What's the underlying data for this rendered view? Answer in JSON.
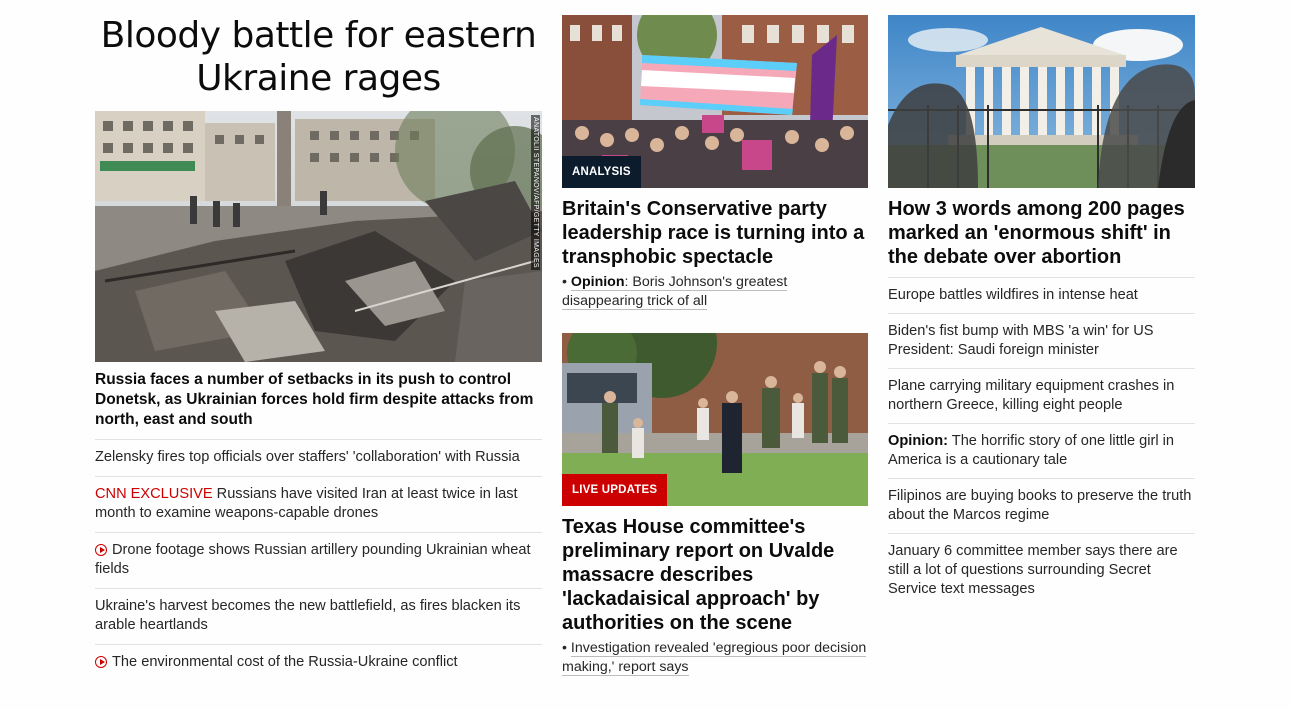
{
  "col1": {
    "headline": "Bloody battle for eastern Ukraine rages",
    "image_credit": "ANATOLII STEPANOV/AFP/GETTY IMAGES",
    "lead": "Russia faces a number of setbacks in its push to control Donetsk, as Ukrainian forces hold firm despite attacks from north, east and south",
    "items": [
      {
        "text": "Zelensky fires top officials over staffers' 'collaboration' with Russia"
      },
      {
        "prefix": "CNN EXCLUSIVE",
        "text": " Russians have visited Iran at least twice in last month to examine weapons-capable drones"
      },
      {
        "icon": "play-icon",
        "text": "Drone footage shows Russian artillery pounding Ukrainian wheat fields"
      },
      {
        "text": "Ukraine's harvest becomes the new battlefield, as fires blacken its arable heartlands"
      },
      {
        "icon": "play-icon",
        "text": "The environmental cost of the Russia-Ukraine conflict"
      }
    ]
  },
  "col2": {
    "story1": {
      "tag": "ANALYSIS",
      "headline": "Britain's Conservative party leadership race is turning into a transphobic spectacle",
      "sub_bullet": "• ",
      "sub_label": "Opinion",
      "sub_text": ": Boris Johnson's greatest disappearing trick of all"
    },
    "story2": {
      "tag": "LIVE UPDATES",
      "headline": "Texas House committee's preliminary report on Uvalde massacre describes 'lackadaisical approach' by authorities on the scene",
      "sub_bullet": "• ",
      "sub_text": "Investigation revealed 'egregious poor decision making,' report says"
    }
  },
  "col3": {
    "headline": "How 3 words among 200 pages marked an 'enormous shift' in the debate over abortion",
    "items": [
      {
        "text": "Europe battles wildfires in intense heat"
      },
      {
        "text": "Biden's fist bump with MBS 'a win' for US President: Saudi foreign minister"
      },
      {
        "text": "Plane carrying military equipment crashes in northern Greece, killing eight people"
      },
      {
        "prefix": "Opinion:",
        "text": " The horrific story of one little girl in America is a cautionary tale"
      },
      {
        "text": "Filipinos are buying books to preserve the truth about the Marcos regime"
      },
      {
        "text": "January 6 committee member says there are still a lot of questions surrounding Secret Service text messages"
      }
    ]
  },
  "colors": {
    "accent_red": "#cc0000",
    "analysis_tag": "#0c1c2c",
    "divider": "#e2e2e2"
  }
}
